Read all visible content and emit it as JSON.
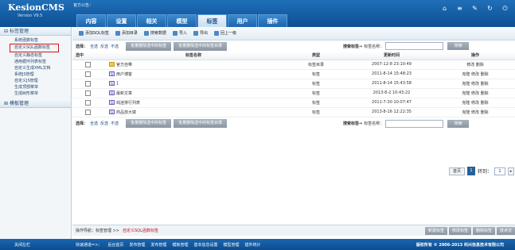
{
  "header": {
    "logo": "KesionCMS",
    "version": "Version V9.5",
    "notice": "官方公告：",
    "tabs": [
      "内容",
      "设置",
      "相关",
      "模型",
      "标签",
      "用户",
      "插件"
    ],
    "active_tab": 4
  },
  "sidebar": {
    "group1": "标签管理",
    "items": [
      "系统函数标签",
      "自定义SQL函数标签",
      "自定义静态标签",
      "通用循环列表标签",
      "自定义生成XML文档",
      "系统JS管理",
      "自定义JS管理",
      "生成顶部菜单",
      "生成树形菜单"
    ],
    "selected": 1,
    "group2": "模板管理"
  },
  "toolbar": [
    "添加SQL标签",
    "添加目录",
    "搜索数据",
    "导入",
    "导出",
    "回上一级"
  ],
  "select": {
    "label": "选择：",
    "all": "全选",
    "invert": "反选",
    "none": "不选",
    "del_tags": "批量删除选中的标签",
    "del_dirs": "批量删除选中的标签目录"
  },
  "search": {
    "label": "搜索标签⇒",
    "field": "标签名称：",
    "button": "搜索"
  },
  "table": {
    "headers": [
      "选中",
      "标签名称",
      "类型",
      "更新时间",
      "操作"
    ],
    "rows": [
      {
        "icon": "folder",
        "name": "官方自带",
        "type": "标签目录",
        "time": "2007-12-8 23:10:49",
        "ops": "修改 删除"
      },
      {
        "icon": "sql",
        "name": "用户博客",
        "type": "标签",
        "time": "2011-8-14 15:48:23",
        "ops": "克隆 修改 删除"
      },
      {
        "icon": "sql",
        "name": "1",
        "type": "标签",
        "time": "2011-8-14 15:43:58",
        "ops": "克隆 修改 删除"
      },
      {
        "icon": "sql",
        "name": "最新文章",
        "type": "标签",
        "time": "2013-8-2 10:43:22",
        "ops": "克隆 修改 删除"
      },
      {
        "icon": "sql",
        "name": "戏迷排行列表",
        "type": "标签",
        "time": "2011-7-30 10:07:47",
        "ops": "克隆 修改 删除"
      },
      {
        "icon": "sql",
        "name": "商品放大镜",
        "type": "标签",
        "time": "2013-8-16 12:22:35",
        "ops": "克隆 修改 删除"
      }
    ]
  },
  "pager": {
    "first": "首页",
    "current": "1",
    "goto": "转到：",
    "page_value": "1"
  },
  "navbar": {
    "label": "操作导航：标签管理 >>",
    "current": "自定义SQL函数标签",
    "buttons": [
      "新建标签",
      "修改标签",
      "删除标签",
      "技术交"
    ]
  },
  "footer": {
    "exit": "关闭左栏",
    "quick": "快速通道=>：",
    "links": [
      "后台首页",
      "发布管理",
      "发布管理",
      "模板管理",
      "基本信息设置",
      "模型管理",
      "插件统计"
    ],
    "copyright": "版权所有 © 2006-2013 科兴信息技术有限公司"
  }
}
